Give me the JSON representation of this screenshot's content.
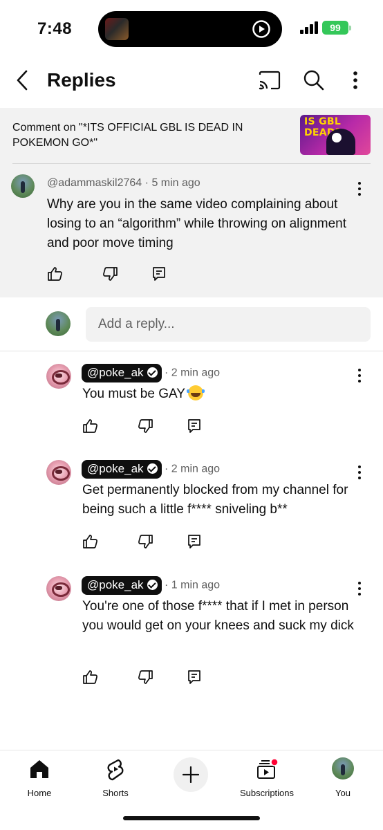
{
  "status": {
    "time": "7:48",
    "battery": "99"
  },
  "header": {
    "title": "Replies"
  },
  "video": {
    "ref_text": "Comment on \"*ITS OFFICIAL GBL IS DEAD IN POKEMON GO*\"",
    "thumb_text": "IS GBL DEAD?"
  },
  "parent_comment": {
    "author": "@adammaskil2764",
    "time": "5 min ago",
    "text": "Why are you in the same video complaining about losing to an “algorithm” while throwing on alignment and poor move timing"
  },
  "reply_input": {
    "placeholder": "Add a reply..."
  },
  "replies": [
    {
      "author": "@poke_ak",
      "time": "2 min ago",
      "text": "You must be GAY"
    },
    {
      "author": "@poke_ak",
      "time": "2 min ago",
      "text": "Get permanently blocked from my channel for being such a little f**** sniveling b**"
    },
    {
      "author": "@poke_ak",
      "time": "1 min ago",
      "text": "You're one of those f**** that if I met in person you would get on your knees and suck my dick"
    }
  ],
  "separator": "·",
  "nav": {
    "home": "Home",
    "shorts": "Shorts",
    "subscriptions": "Subscriptions",
    "you": "You"
  },
  "colors": {
    "accent_red": "#ff0033",
    "battery_green": "#34c759"
  }
}
